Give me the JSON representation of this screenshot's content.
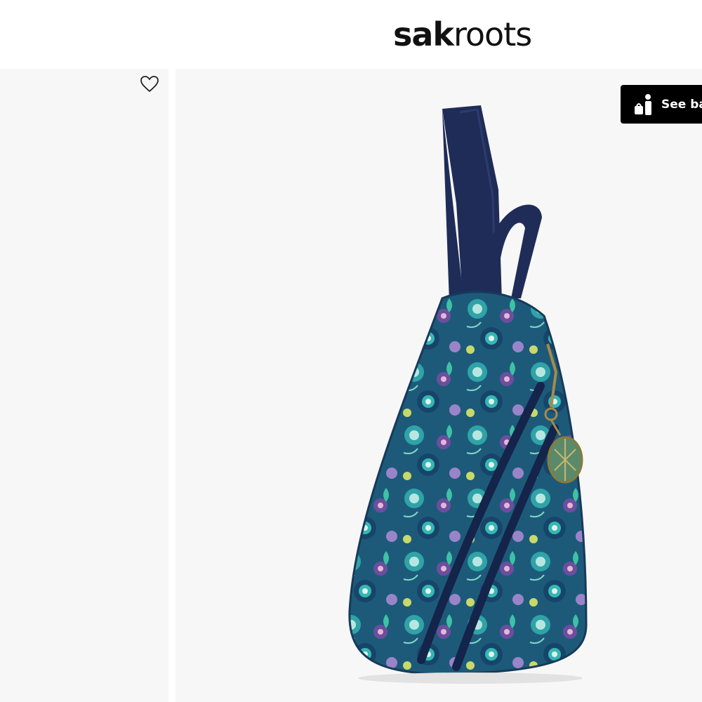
{
  "header": {
    "logo_bold": "sak",
    "logo_light": "roots"
  },
  "product": {
    "favorite_icon": "heart-outline-icon",
    "see_button_label": "See ba",
    "see_button_icon": "person-with-bag-icon",
    "image": "sling-backpack-floral-print",
    "colors": {
      "strap": "#1f2c57",
      "base_print": "#1d5a7a",
      "accent_teal": "#2fa3a8"
    }
  }
}
